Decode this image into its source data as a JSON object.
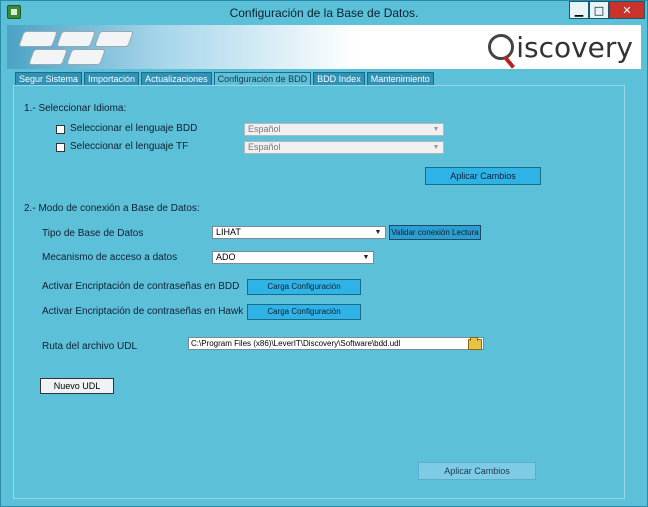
{
  "window": {
    "title": "Configuración de la Base de Datos.",
    "min_glyph": "▁",
    "max_glyph": "□",
    "close_glyph": "✕"
  },
  "banner": {
    "brand": "iscovery"
  },
  "tabs": [
    {
      "label": "Segur Sistema",
      "active": false
    },
    {
      "label": "Importación",
      "active": false
    },
    {
      "label": "Actualizaciones",
      "active": false
    },
    {
      "label": "Configuración de BDD",
      "active": true
    },
    {
      "label": "BDD Index",
      "active": false
    },
    {
      "label": "Mantenimiento",
      "active": false
    }
  ],
  "section1": {
    "heading": "1.- Seleccionar Idioma:",
    "bdd_checkbox_label": "Seleccionar el lenguaje BDD",
    "bdd_checked": false,
    "bdd_language_value": "Español",
    "tf_checkbox_label": "Seleccionar el lenguaje TF",
    "tf_checked": false,
    "tf_language_value": "Español",
    "apply_button": "Aplicar Cambios"
  },
  "section2": {
    "heading": "2.- Modo de conexión a Base de Datos:",
    "db_type_label": "Tipo de Base de Datos",
    "db_type_value": "LIHAT",
    "validate_button": "Validar conexión Lectura",
    "access_label": "Mecanismo de acceso a datos",
    "access_value": "ADO",
    "encrypt_bdd_label": "Activar Encriptación de contraseñas en BDD",
    "encrypt_bdd_button": "Carga Configuración",
    "encrypt_hawk_label": "Activar Encriptación de contraseñas en Hawk",
    "encrypt_hawk_button": "Carga Configuración",
    "udl_label": "Ruta del archivo UDL",
    "udl_value": "C:\\Program Files (x86)\\LeverIT\\Discovery\\Software\\bdd.udl",
    "new_udl_button": "Nuevo UDL"
  },
  "footer": {
    "apply_button": "Aplicar Cambios"
  },
  "icons": {
    "app": "app-icon",
    "folder": "folder-open-icon",
    "dropdown": "chevron-down-icon",
    "magnifier": "magnifier-logo-icon"
  },
  "colors": {
    "window_bg": "#5cc0d8",
    "button_blue": "#2fb3e6",
    "close_red": "#c9332c"
  }
}
